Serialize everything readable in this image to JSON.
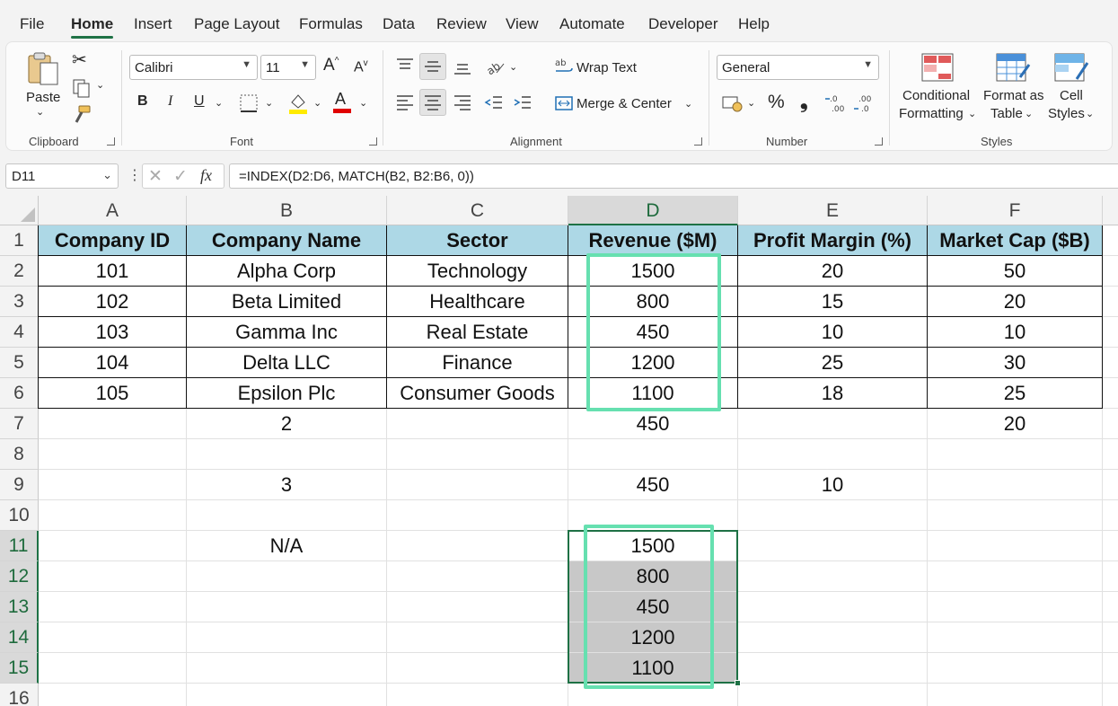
{
  "menu": [
    "File",
    "Home",
    "Insert",
    "Page Layout",
    "Formulas",
    "Data",
    "Review",
    "View",
    "Automate",
    "Developer",
    "Help"
  ],
  "ribbon": {
    "clipboard": {
      "paste_label": "Paste",
      "group_label": "Clipboard"
    },
    "font": {
      "font_name": "Calibri",
      "font_size": "11",
      "bold": "B",
      "italic": "I",
      "underline": "U",
      "group_label": "Font"
    },
    "alignment": {
      "wrap_text": "Wrap Text",
      "merge_center": "Merge & Center",
      "group_label": "Alignment"
    },
    "number": {
      "format": "General",
      "percent": "%",
      "comma": "❟",
      "group_label": "Number"
    },
    "styles": {
      "conditional_1": "Conditional",
      "conditional_2": "Formatting",
      "format_as_1": "Format as",
      "format_as_2": "Table",
      "cell_styles_1": "Cell",
      "cell_styles_2": "Styles",
      "group_label": "Styles"
    }
  },
  "formula_bar": {
    "name_box": "D11",
    "fx": "fx",
    "formula": "=INDEX(D2:D6, MATCH(B2, B2:B6, 0))"
  },
  "columns": [
    "A",
    "B",
    "C",
    "D",
    "E",
    "F"
  ],
  "rows": [
    "1",
    "2",
    "3",
    "4",
    "5",
    "6",
    "7",
    "8",
    "9",
    "10",
    "11",
    "12",
    "13",
    "14",
    "15",
    "16"
  ],
  "cells": [
    [
      "Company ID",
      "Company Name",
      "Sector",
      "Revenue ($M)",
      "Profit Margin (%)",
      "Market Cap ($B)"
    ],
    [
      "101",
      "Alpha Corp",
      "Technology",
      "1500",
      "20",
      "50"
    ],
    [
      "102",
      "Beta Limited",
      "Healthcare",
      "800",
      "15",
      "20"
    ],
    [
      "103",
      "Gamma Inc",
      "Real Estate",
      "450",
      "10",
      "10"
    ],
    [
      "104",
      "Delta LLC",
      "Finance",
      "1200",
      "25",
      "30"
    ],
    [
      "105",
      "Epsilon Plc",
      "Consumer Goods",
      "1100",
      "18",
      "25"
    ],
    [
      "",
      "2",
      "",
      "450",
      "",
      "20"
    ],
    [
      "",
      "",
      "",
      "",
      "",
      ""
    ],
    [
      "",
      "3",
      "",
      "450",
      "10",
      ""
    ],
    [
      "",
      "",
      "",
      "",
      "",
      ""
    ],
    [
      "",
      "N/A",
      "",
      "1500",
      "",
      ""
    ],
    [
      "",
      "",
      "",
      "800",
      "",
      ""
    ],
    [
      "",
      "",
      "",
      "450",
      "",
      ""
    ],
    [
      "",
      "",
      "",
      "1200",
      "",
      ""
    ],
    [
      "",
      "",
      "",
      "1100",
      "",
      ""
    ],
    [
      "",
      "",
      "",
      "",
      "",
      ""
    ]
  ],
  "colors": {
    "accent": "#1e7145",
    "header_fill": "#add8e6",
    "highlight": "#66e0b0",
    "spill_fill": "#c8c8c8"
  }
}
